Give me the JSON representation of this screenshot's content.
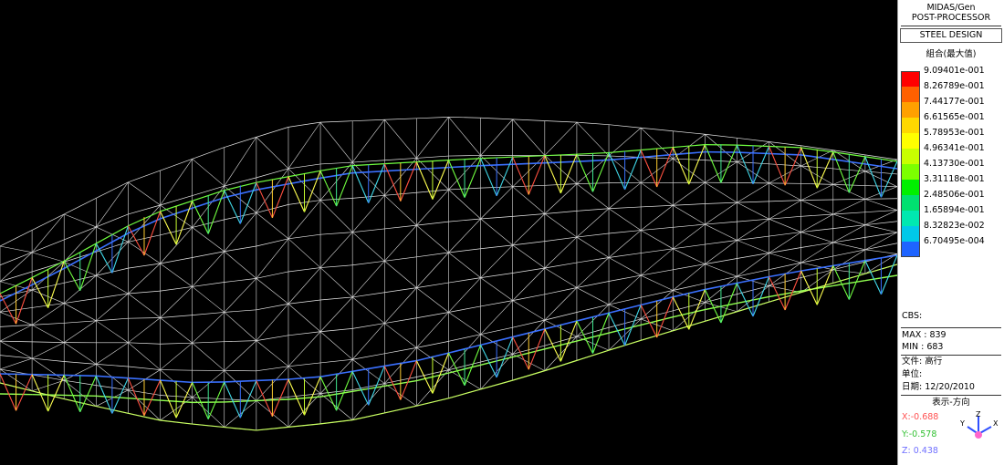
{
  "app": {
    "name": "MIDAS/Gen",
    "mode": "POST-PROCESSOR"
  },
  "panel": {
    "design_label": "STEEL DESIGN",
    "result_title": "組合(最大值)",
    "legend": [
      {
        "value": "9.09401e-001",
        "color": "#ff0000"
      },
      {
        "value": "8.26789e-001",
        "color": "#ff6000"
      },
      {
        "value": "7.44177e-001",
        "color": "#ffa000"
      },
      {
        "value": "6.61565e-001",
        "color": "#ffd800"
      },
      {
        "value": "5.78953e-001",
        "color": "#ffff00"
      },
      {
        "value": "4.96341e-001",
        "color": "#c8ff00"
      },
      {
        "value": "4.13730e-001",
        "color": "#7cff00"
      },
      {
        "value": "3.31118e-001",
        "color": "#00f000"
      },
      {
        "value": "2.48506e-001",
        "color": "#00e070"
      },
      {
        "value": "1.65894e-001",
        "color": "#00e8b0"
      },
      {
        "value": "8.32823e-002",
        "color": "#00c8e8"
      },
      {
        "value": "6.70495e-004",
        "color": "#1e64ff"
      }
    ],
    "cbs_label": "CBS:",
    "max_line": "MAX : 839",
    "min_line": "MIN : 683",
    "file_line": "文件: 高行",
    "unit_line": "单位:",
    "date_line": "日期:  12/20/2010",
    "view_direction_title": "表示-方向",
    "view_x": "X:-0.688",
    "view_y": "Y:-0.578",
    "view_z": "Z: 0.438",
    "axis_labels": {
      "x": "X",
      "y": "Y",
      "z": "Z"
    },
    "view_colors": {
      "x": "#ff5050",
      "y": "#30c030",
      "z": "#7070ff"
    }
  }
}
